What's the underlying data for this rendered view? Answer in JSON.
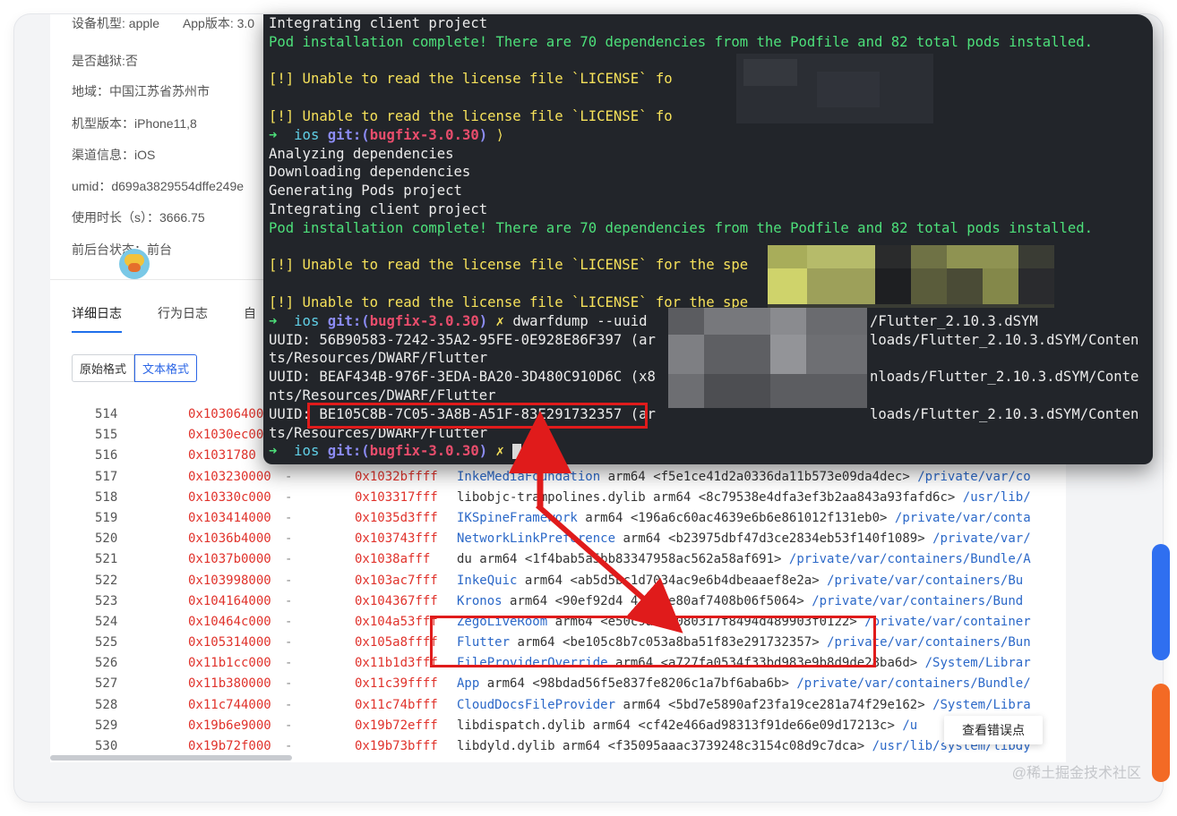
{
  "device_info": {
    "model": "设备机型: apple",
    "app_version": "App版本: 3.0",
    "jailbreak": "是否越狱:否",
    "region": "地域：中国江苏省苏州市",
    "model_version": "机型版本：iPhone11,8",
    "channel": "渠道信息：iOS",
    "umid": "umid：d699a3829554dffe249e",
    "duration": "使用时长（s）：3666.75",
    "foreground": "前后台状态：前台"
  },
  "tabs": [
    "详细日志",
    "行为日志",
    "自"
  ],
  "format_buttons": [
    "原始格式",
    "文本格式"
  ],
  "log_rows": [
    {
      "n": "514",
      "a1": "0x10306400",
      "a2": "",
      "lib": "",
      "arch": "",
      "uuid": "",
      "path": ""
    },
    {
      "n": "515",
      "a1": "0x1030ec00",
      "a2": "",
      "lib": "",
      "arch": "",
      "uuid": "",
      "path": ""
    },
    {
      "n": "516",
      "a1": "0x1031780",
      "a2": "",
      "lib": "",
      "arch": "",
      "uuid": "",
      "path": ""
    },
    {
      "n": "517",
      "a1": "0x103230000",
      "a2": "0x1032bffff",
      "lib": "InkeMediaFoundation",
      "arch": "arm64",
      "uuid": "<f5e1ce41d2a0336da11b573e09da4dec>",
      "path": "/private/var/co"
    },
    {
      "n": "518",
      "a1": "0x10330c000",
      "a2": "0x103317fff",
      "lib": "libobjc-trampolines.dylib",
      "arch": "arm64",
      "uuid": "<8c79538e4dfa3ef3b2aa843a93fafd6c>",
      "path": "/usr/lib/"
    },
    {
      "n": "519",
      "a1": "0x103414000",
      "a2": "0x1035d3fff",
      "lib": "IKSpineFramework",
      "arch": "arm64",
      "uuid": "<196a6c60ac4639e6b6e861012f131eb0>",
      "path": "/private/var/conta"
    },
    {
      "n": "520",
      "a1": "0x1036b4000",
      "a2": "0x103743fff",
      "lib": "NetworkLinkPreference",
      "arch": "arm64",
      "uuid": "<b23975dbf47d3ce2834eb53f140f1089>",
      "path": "/private/var/"
    },
    {
      "n": "521",
      "a1": "0x1037b0000",
      "a2": "0x1038afff",
      "lib": "du",
      "arch": "arm64",
      "uuid": "<1f4bab5a5bb83347958ac562a58af691>",
      "path": "/private/var/containers/Bundle/A"
    },
    {
      "n": "522",
      "a1": "0x103998000",
      "a2": "0x103ac7fff",
      "lib": "InkeQuic",
      "arch": "arm64",
      "uuid": "<ab5d5bc1d7034ac9e6b4dbeaaef8e2a>",
      "path": "/private/var/containers/Bu"
    },
    {
      "n": "523",
      "a1": "0x104164000",
      "a2": "0x104367fff",
      "lib": "Kronos",
      "arch": "arm64",
      "uuid": "<90ef92d4  423fce80af7408b06f5064>",
      "path": "/private/var/containers/Bund"
    },
    {
      "n": "524",
      "a1": "0x10464c000",
      "a2": "0x104a53fff",
      "lib": "ZegoLiveRoom",
      "arch": "arm64",
      "uuid": "<e50c9a8c0080317f8494d489903f0122>",
      "path": "/private/var/container"
    },
    {
      "n": "525",
      "a1": "0x105314000",
      "a2": "0x105a8ffff",
      "lib": "Flutter",
      "arch": "arm64",
      "uuid": "<be105c8b7c053a8ba51f83e291732357>",
      "path": "/private/var/containers/Bun"
    },
    {
      "n": "526",
      "a1": "0x11b1cc000",
      "a2": "0x11b1d3fff",
      "lib": "FileProviderOverride",
      "arch": "arm64",
      "uuid": "<a727fa0534f33bd983e9b8d9de28ba6d>",
      "path": "/System/Librar"
    },
    {
      "n": "527",
      "a1": "0x11b380000",
      "a2": "0x11c39ffff",
      "lib": "App",
      "arch": "arm64",
      "uuid": "<98bdad56f5e837fe8206c1a7bf6aba6b>",
      "path": "/private/var/containers/Bundle/"
    },
    {
      "n": "528",
      "a1": "0x11c744000",
      "a2": "0x11c74bfff",
      "lib": "CloudDocsFileProvider",
      "arch": "arm64",
      "uuid": "<5bd7e5890af23fa19ce281a74f29e162>",
      "path": "/System/Libra"
    },
    {
      "n": "529",
      "a1": "0x19b6e9000",
      "a2": "0x19b72efff",
      "lib": "libdispatch.dylib",
      "arch": "arm64",
      "uuid": "<cf42e466ad98313f91de66e09d17213c>",
      "path": "/u"
    },
    {
      "n": "530",
      "a1": "0x19b72f000",
      "a2": "0x19b73bfff",
      "lib": "libdyld.dylib",
      "arch": "arm64",
      "uuid": "<f35095aaac3739248c3154c08d9c7dca>",
      "path": "/usr/lib/system/libdy"
    }
  ],
  "view_errors_button": "查看错误点",
  "watermark": "@稀土掘金技术社区",
  "terminal": {
    "lines": [
      {
        "kind": "white",
        "text": "Integrating client project"
      },
      {
        "kind": "green",
        "text": "Pod installation complete! There are 70 dependencies from the Podfile and 82 total pods installed."
      },
      {
        "kind": "blank",
        "text": ""
      },
      {
        "kind": "yellow",
        "text": "[!] Unable to read the license file `LICENSE` fo"
      },
      {
        "kind": "blank",
        "text": ""
      },
      {
        "kind": "yellow",
        "text": "[!] Unable to read the license file `LICENSE` fo"
      },
      {
        "kind": "prompt",
        "text": "",
        "tail": "⟩"
      },
      {
        "kind": "white",
        "text": "Analyzing dependencies"
      },
      {
        "kind": "white",
        "text": "Downloading dependencies"
      },
      {
        "kind": "white",
        "text": "Generating Pods project"
      },
      {
        "kind": "white",
        "text": "Integrating client project"
      },
      {
        "kind": "green",
        "text": "Pod installation complete! There are 70 dependencies from the Podfile and 82 total pods installed."
      },
      {
        "kind": "blank",
        "text": ""
      },
      {
        "kind": "yellow",
        "text": "[!] Unable to read the license file `LICENSE` for the spe"
      },
      {
        "kind": "blank",
        "text": ""
      },
      {
        "kind": "yellow",
        "text": "[!] Unable to read the license file `LICENSE` for the spe"
      },
      {
        "kind": "prompt",
        "text": "dwarfdump --uuid",
        "tail": "✗",
        "right": "/Flutter_2.10.3.dSYM"
      },
      {
        "kind": "white",
        "text": "UUID: 56B90583-7242-35A2-95FE-0E928E86F397 (ar",
        "right": "loads/Flutter_2.10.3.dSYM/Conten"
      },
      {
        "kind": "white",
        "text": "ts/Resources/DWARF/Flutter"
      },
      {
        "kind": "white",
        "text": "UUID: BEAF434B-976F-3EDA-BA20-3D480C910D6C (x8",
        "right": "nloads/Flutter_2.10.3.dSYM/Conte"
      },
      {
        "kind": "white",
        "text": "nts/Resources/DWARF/Flutter"
      },
      {
        "kind": "white",
        "text": "UUID: BE105C8B-7C05-3A8B-A51F-83E291732357 (ar",
        "right": "loads/Flutter_2.10.3.dSYM/Conten"
      },
      {
        "kind": "white",
        "text": "ts/Resources/DWARF/Flutter"
      },
      {
        "kind": "prompt_cursor",
        "text": "",
        "tail": "✗"
      }
    ],
    "prompt_arrow": "➜",
    "prompt_dir": "ios",
    "prompt_git": "git:(",
    "prompt_branch": "bugfix-3.0.30",
    "prompt_close": ")"
  },
  "colors": {
    "terminal_bg": "#22252a",
    "term_green": "#4de07a",
    "term_yellow": "#f6e15a",
    "address_red": "#e0322b",
    "lib_blue": "#2b68c8",
    "annotation_red": "#e01b1b",
    "tab_active": "#1f6feb"
  }
}
